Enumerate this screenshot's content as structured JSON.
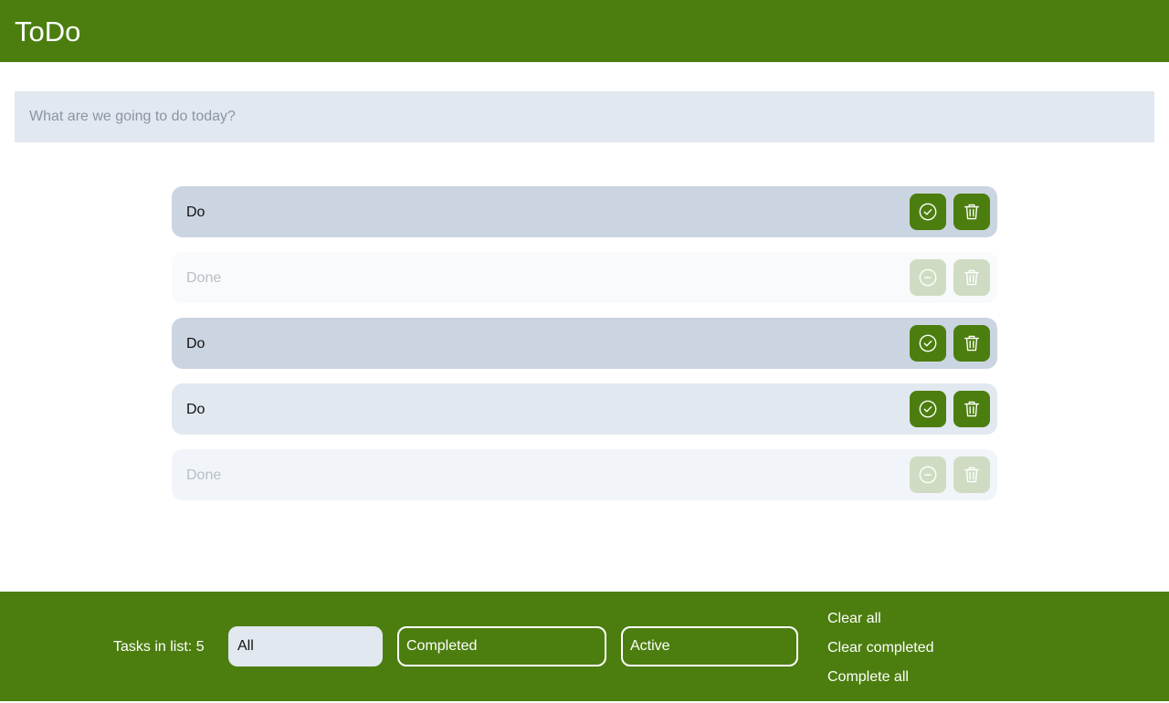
{
  "app": {
    "title": "ToDo"
  },
  "new_task": {
    "placeholder": "What are we going to do today?",
    "value": ""
  },
  "tasks": [
    {
      "label": "Do",
      "status": "active",
      "action_icon": "check-circle-icon"
    },
    {
      "label": "Done",
      "status": "done",
      "action_icon": "minus-circle-icon"
    },
    {
      "label": "Do",
      "status": "active",
      "action_icon": "check-circle-icon"
    },
    {
      "label": "Do",
      "status": "active",
      "action_icon": "check-circle-icon"
    },
    {
      "label": "Done",
      "status": "done",
      "action_icon": "minus-circle-icon"
    }
  ],
  "footer": {
    "count_text": "Tasks in list: 5",
    "filters": [
      {
        "label": "All",
        "selected": true
      },
      {
        "label": "Completed",
        "selected": false
      },
      {
        "label": "Active",
        "selected": false
      }
    ],
    "actions": {
      "clear_all": "Clear all",
      "clear_completed": "Clear completed",
      "complete_all": "Complete all"
    }
  },
  "colors": {
    "brand": "#4c7e0f",
    "input_bg": "#e1e8f0",
    "done_text": "#b9bec6"
  }
}
